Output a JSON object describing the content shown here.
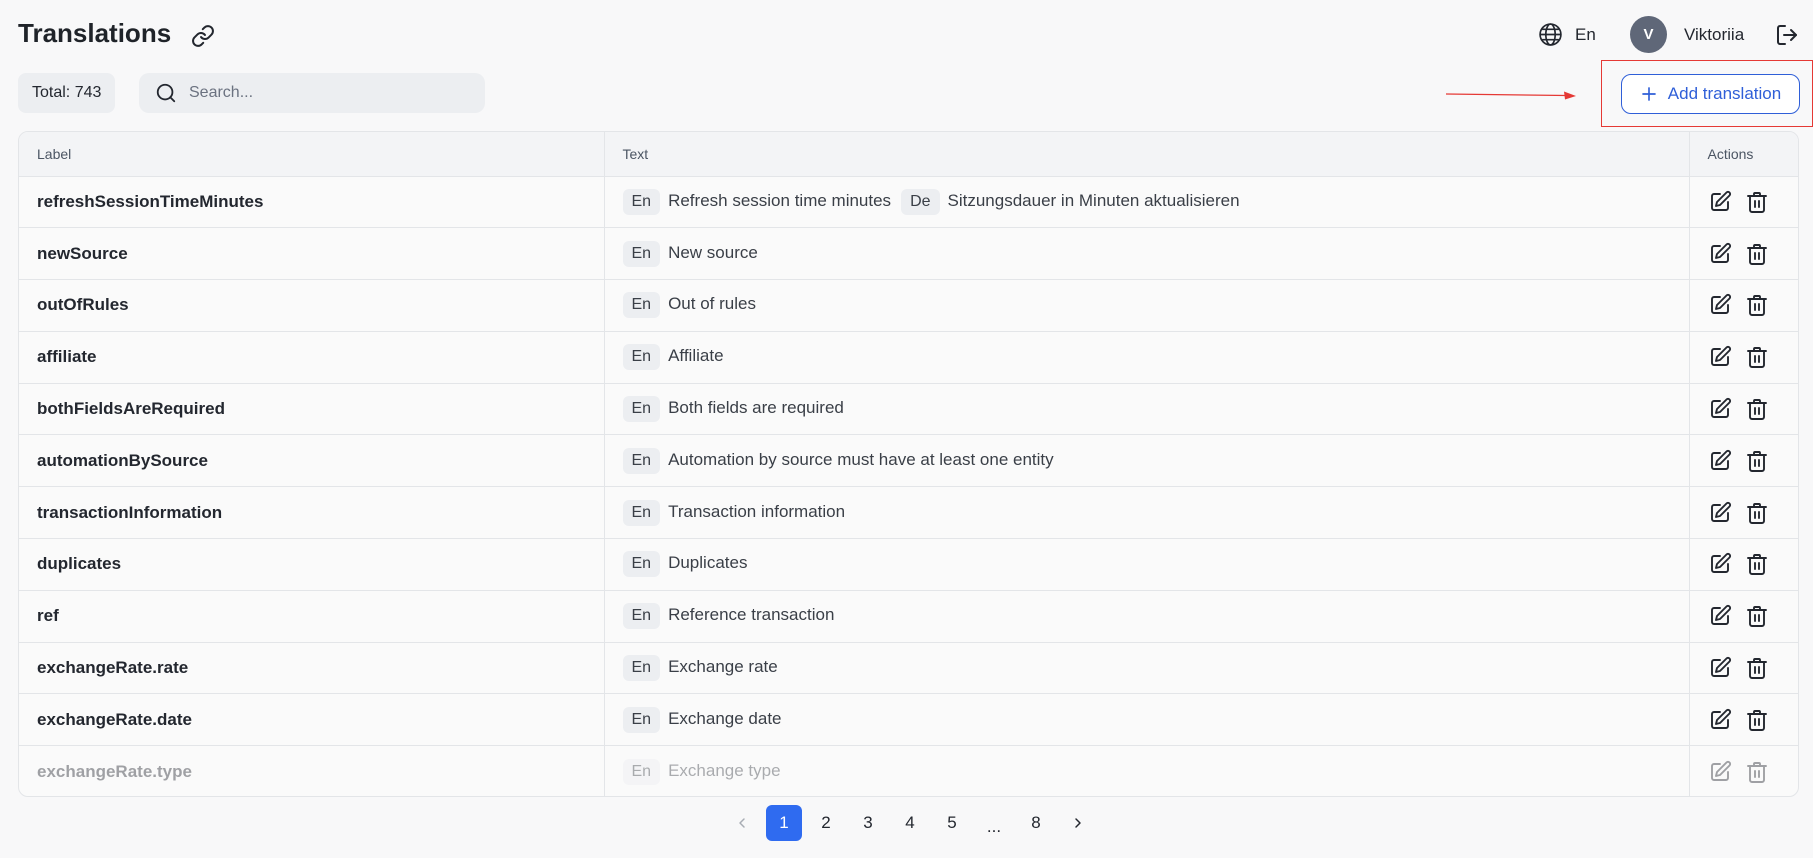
{
  "header": {
    "title": "Translations",
    "language": "En",
    "user": {
      "initial": "V",
      "name": "Viktoriia"
    }
  },
  "toolbar": {
    "total_label": "Total: 743",
    "search_placeholder": "Search...",
    "add_label": "Add translation"
  },
  "table": {
    "columns": {
      "label": "Label",
      "text": "Text",
      "actions": "Actions"
    },
    "rows": [
      {
        "label": "refreshSessionTimeMinutes",
        "translations": [
          {
            "lang": "En",
            "text": "Refresh session time minutes"
          },
          {
            "lang": "De",
            "text": "Sitzungsdauer in Minuten aktualisieren"
          }
        ]
      },
      {
        "label": "newSource",
        "translations": [
          {
            "lang": "En",
            "text": "New source"
          }
        ]
      },
      {
        "label": "outOfRules",
        "translations": [
          {
            "lang": "En",
            "text": "Out of rules"
          }
        ]
      },
      {
        "label": "affiliate",
        "translations": [
          {
            "lang": "En",
            "text": "Affiliate"
          }
        ]
      },
      {
        "label": "bothFieldsAreRequired",
        "translations": [
          {
            "lang": "En",
            "text": "Both fields are required"
          }
        ]
      },
      {
        "label": "automationBySource",
        "translations": [
          {
            "lang": "En",
            "text": "Automation by source must have at least one entity"
          }
        ]
      },
      {
        "label": "transactionInformation",
        "translations": [
          {
            "lang": "En",
            "text": "Transaction information"
          }
        ]
      },
      {
        "label": "duplicates",
        "translations": [
          {
            "lang": "En",
            "text": "Duplicates"
          }
        ]
      },
      {
        "label": "ref",
        "translations": [
          {
            "lang": "En",
            "text": "Reference transaction"
          }
        ]
      },
      {
        "label": "exchangeRate.rate",
        "translations": [
          {
            "lang": "En",
            "text": "Exchange rate"
          }
        ]
      },
      {
        "label": "exchangeRate.date",
        "translations": [
          {
            "lang": "En",
            "text": "Exchange date"
          }
        ]
      },
      {
        "label": "exchangeRate.type",
        "translations": [
          {
            "lang": "En",
            "text": "Exchange type"
          }
        ]
      }
    ]
  },
  "pagination": {
    "pages": [
      "1",
      "2",
      "3",
      "4",
      "5",
      "...",
      "8"
    ],
    "current": "1"
  },
  "colors": {
    "accent": "#2f6bf0",
    "button_border": "#2f5fd8",
    "annotation": "#e53935",
    "avatar": "#5f6778"
  },
  "icons": {
    "title_action": "link-icon",
    "language": "globe-icon",
    "logout": "logout-icon",
    "search": "search-icon",
    "add": "plus-icon",
    "edit": "edit-icon",
    "delete": "trash-icon",
    "prev": "chevron-left-icon",
    "next": "chevron-right-icon"
  }
}
